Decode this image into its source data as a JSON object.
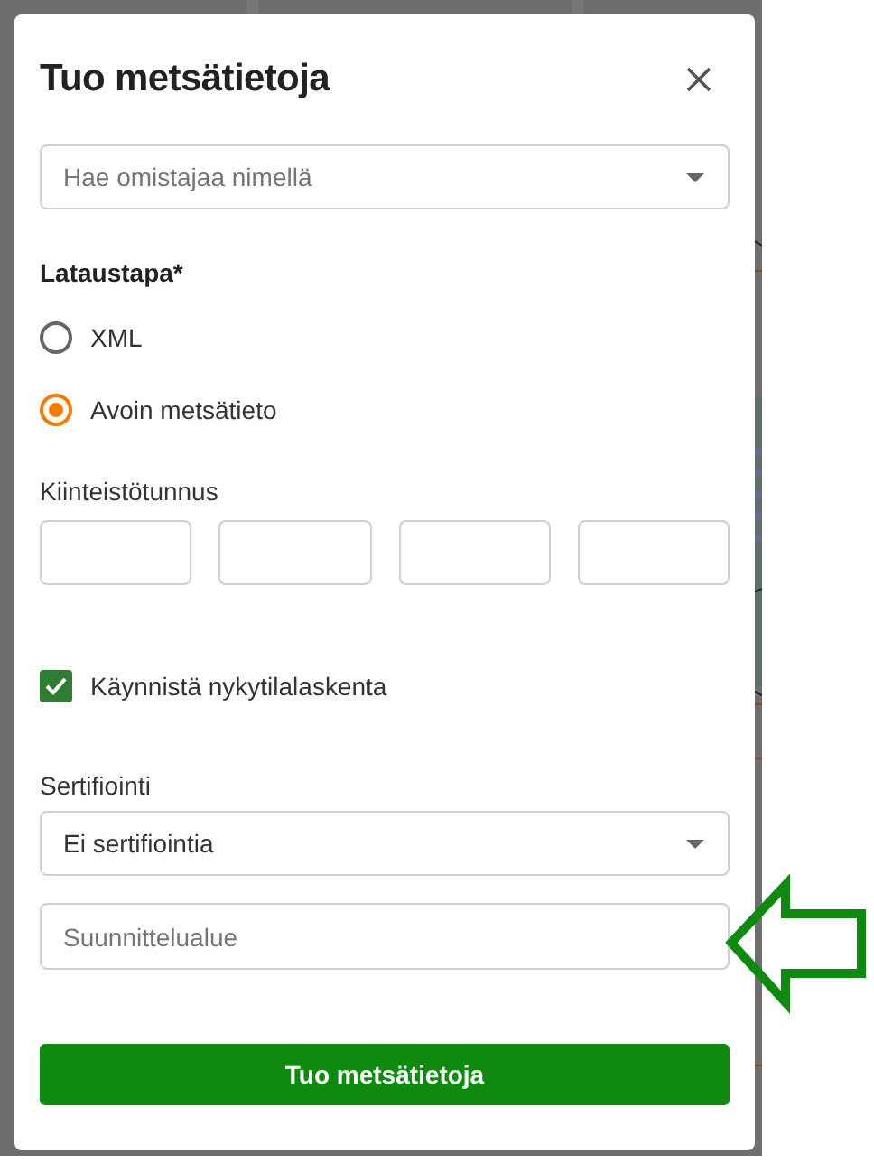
{
  "dialog": {
    "title": "Tuo metsätietoja"
  },
  "owner_search": {
    "placeholder": "Hae omistajaa nimellä"
  },
  "load_method": {
    "label": "Lataustapa*",
    "options": [
      {
        "label": "XML",
        "selected": false
      },
      {
        "label": "Avoin metsätieto",
        "selected": true
      }
    ]
  },
  "property_id": {
    "label": "Kiinteistötunnus",
    "parts": [
      {
        "kind": "text"
      },
      {
        "kind": "text"
      },
      {
        "kind": "text"
      },
      {
        "kind": "text"
      }
    ]
  },
  "start_calculation": {
    "label": "Käynnistä nykytilalaskenta",
    "checked": true
  },
  "certification": {
    "label": "Sertifiointi",
    "value": "Ei sertifiointia"
  },
  "planning_area": {
    "placeholder": "Suunnittelualue"
  },
  "submit": {
    "label": "Tuo metsätietoja"
  }
}
